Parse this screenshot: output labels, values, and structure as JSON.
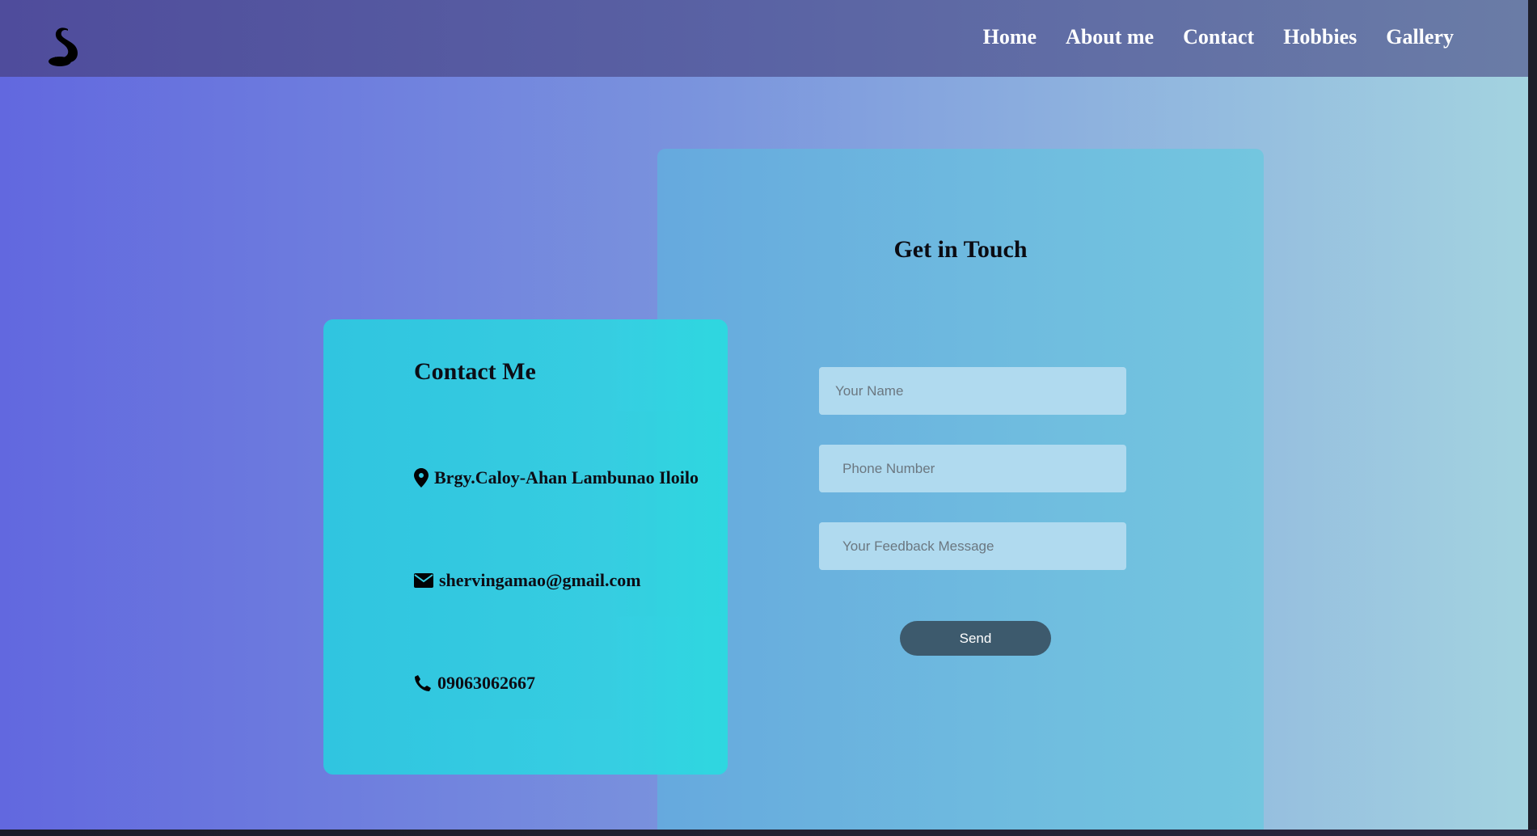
{
  "header": {
    "logo_icon": "swan-icon",
    "nav": [
      {
        "label": "Home"
      },
      {
        "label": "About me"
      },
      {
        "label": "Contact"
      },
      {
        "label": "Hobbies"
      },
      {
        "label": "Gallery"
      }
    ]
  },
  "get_in_touch": {
    "title": "Get in Touch",
    "name_placeholder": "Your Name",
    "phone_placeholder": "Phone Number",
    "message_placeholder": "Your Feedback Message",
    "send_label": "Send"
  },
  "contact": {
    "title": "Contact Me",
    "address": "Brgy.Caloy-Ahan Lambunao Iloilo",
    "address_icon": "map-marker-icon",
    "email": "shervingamao@gmail.com",
    "email_icon": "envelope-icon",
    "phone": "09063062667",
    "phone_icon": "phone-icon"
  },
  "colors": {
    "header": "#5a63a4",
    "contact_card": "#33cbe1",
    "touch_panel": "#6fbcdf",
    "input_bg": "#b0daef",
    "send_button": "#3d5a6d"
  }
}
